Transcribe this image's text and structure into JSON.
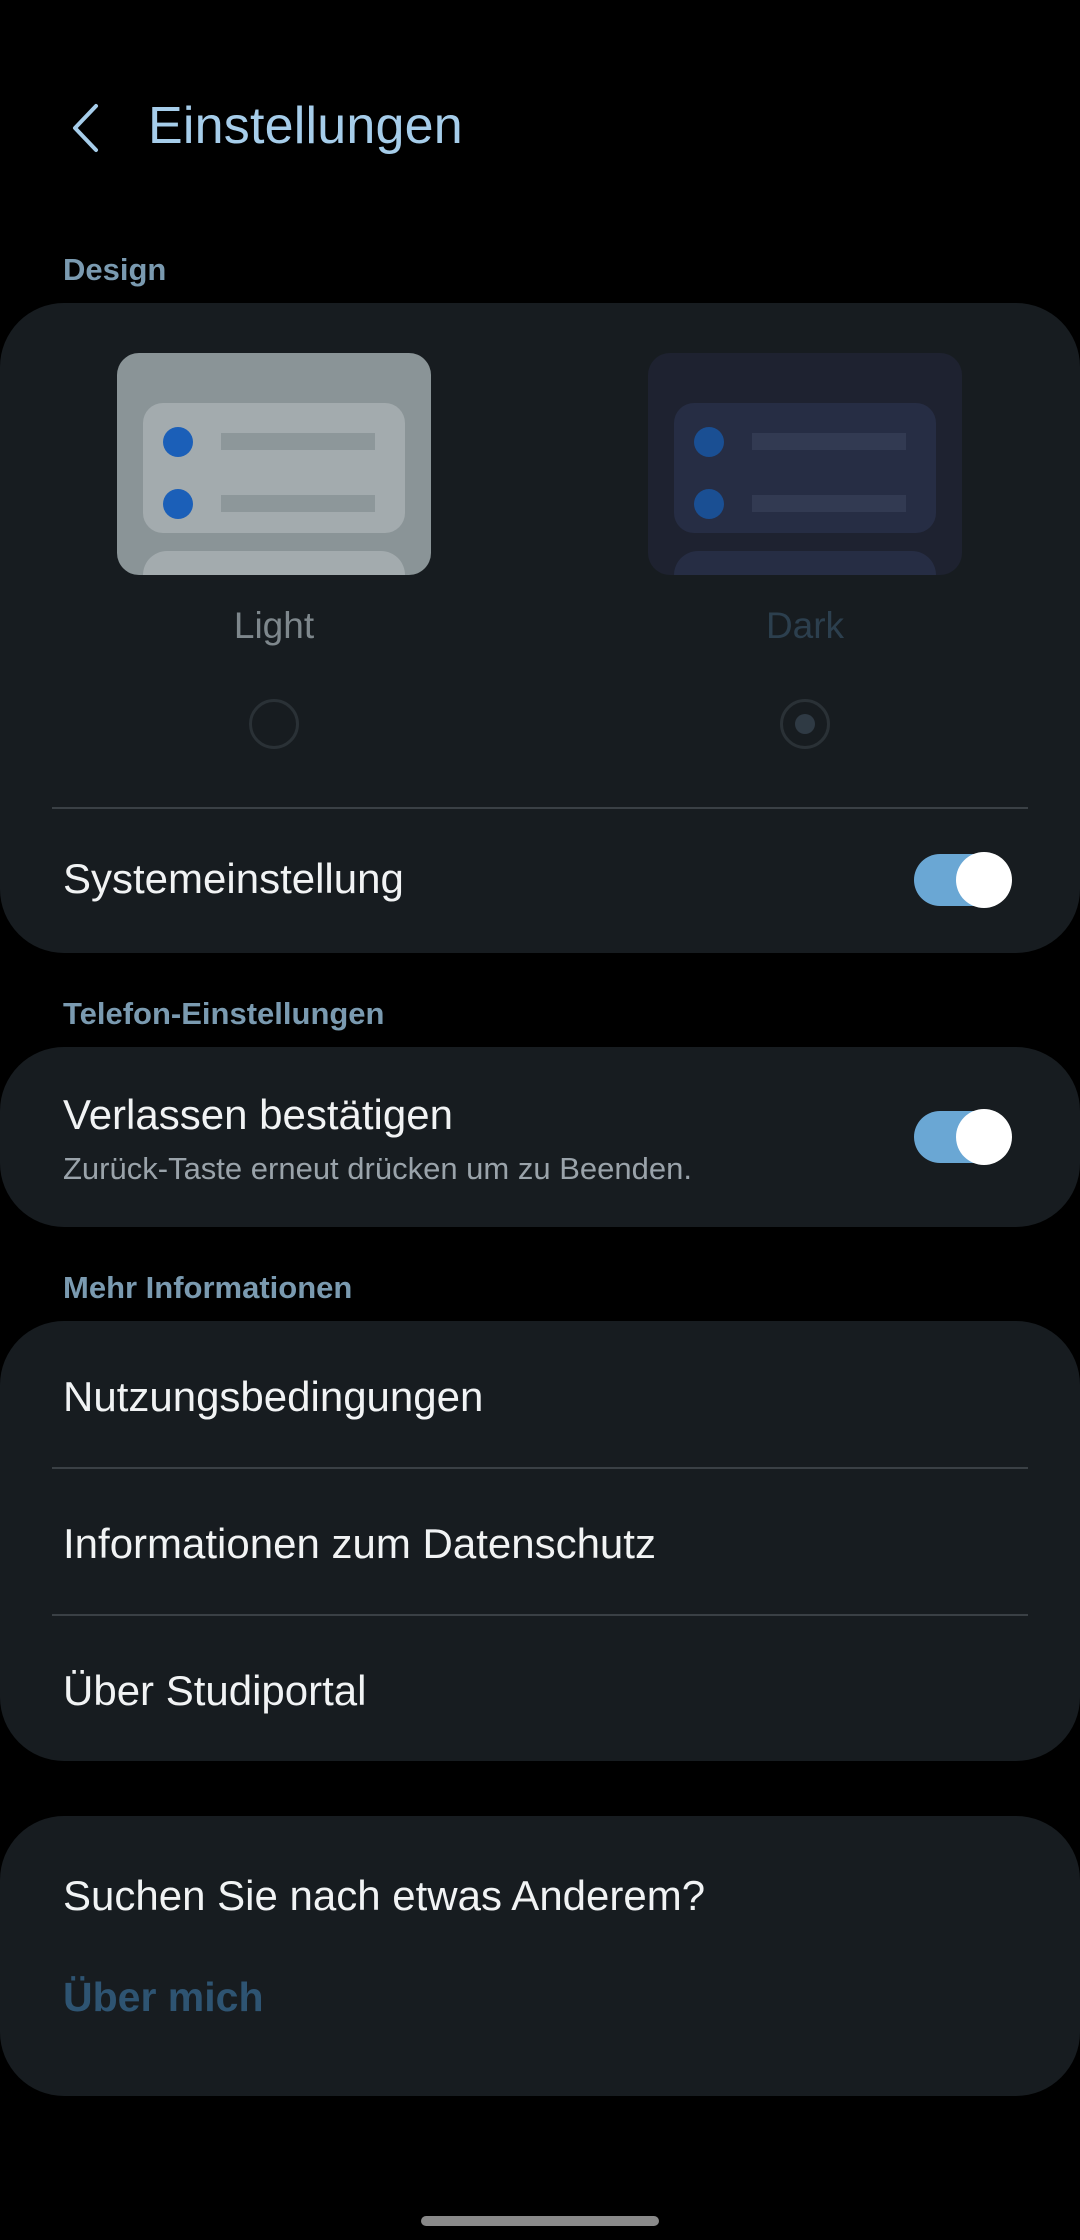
{
  "header": {
    "title": "Einstellungen",
    "back_icon": "chevron-left-icon"
  },
  "design": {
    "section_label": "Design",
    "themes": [
      {
        "label": "Light",
        "selected": false
      },
      {
        "label": "Dark",
        "selected": true
      }
    ],
    "system_setting": {
      "label": "Systemeinstellung",
      "enabled": true
    }
  },
  "phone_settings": {
    "section_label": "Telefon-Einstellungen",
    "confirm_exit": {
      "label": "Verlassen bestätigen",
      "description": "Zurück-Taste erneut drücken um zu Beenden.",
      "enabled": true
    }
  },
  "more_info": {
    "section_label": "Mehr Informationen",
    "items": [
      {
        "label": "Nutzungsbedingungen"
      },
      {
        "label": "Informationen zum Datenschutz"
      },
      {
        "label": "Über Studiportal"
      }
    ]
  },
  "other": {
    "question": "Suchen Sie nach etwas Anderem?",
    "link": "Über mich"
  },
  "colors": {
    "background": "#000000",
    "card": "#171c20",
    "title": "#a6cdea",
    "toggle_on": "#6aa7d4",
    "section_label": "#7a9ab0",
    "link": "#2e5472"
  }
}
